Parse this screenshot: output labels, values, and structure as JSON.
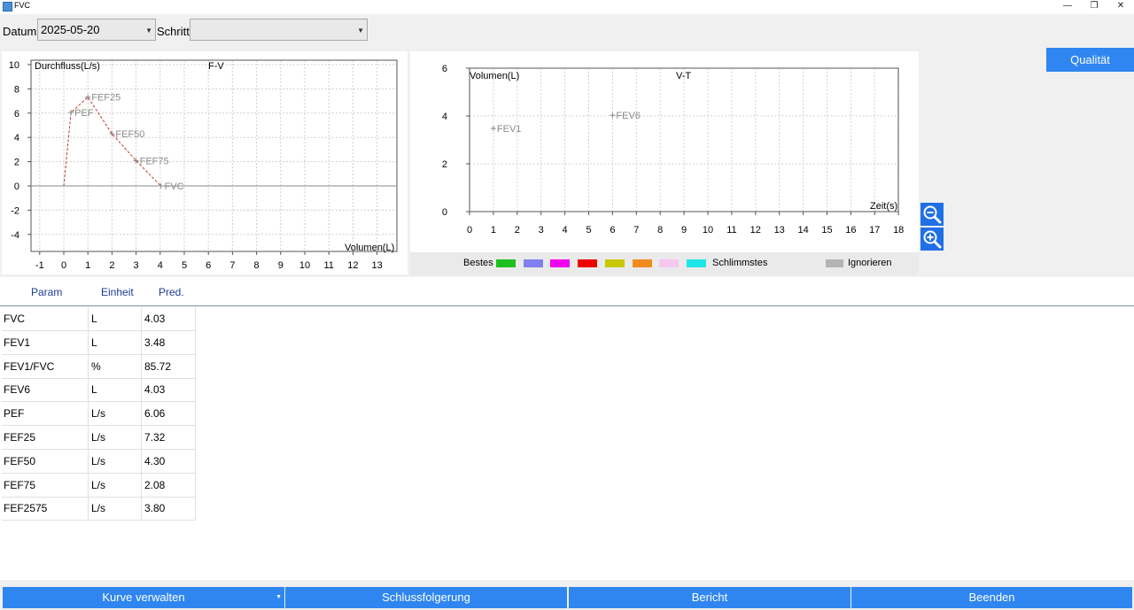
{
  "window": {
    "title": "FVC",
    "minimize": "—",
    "restore": "❐",
    "close": "✕"
  },
  "toolbar": {
    "date_label": "Datum:",
    "date_value": "2025-05-20",
    "step_label": "Schritt:",
    "step_value": ""
  },
  "fv_chart": {
    "title": "F-V",
    "ylabel": "Durchfluss(L/s)",
    "xlabel": "Volumen(L)",
    "x_ticks": [
      "-1",
      "0",
      "1",
      "2",
      "3",
      "4",
      "5",
      "6",
      "7",
      "8",
      "9",
      "10",
      "11",
      "12",
      "13"
    ],
    "y_ticks": [
      "10",
      "8",
      "6",
      "4",
      "2",
      "0",
      "-2",
      "-4"
    ],
    "points": [
      {
        "label": "",
        "x": 0,
        "y": 0
      },
      {
        "label": "PEF",
        "x": 0.3,
        "y": 6.06
      },
      {
        "label": "FEF25",
        "x": 1.0,
        "y": 7.32
      },
      {
        "label": "FEF50",
        "x": 2.0,
        "y": 4.3
      },
      {
        "label": "FEF75",
        "x": 3.0,
        "y": 2.08
      },
      {
        "label": "FVC",
        "x": 4.03,
        "y": 0
      }
    ],
    "line_color": "#c0392b"
  },
  "vt_chart": {
    "title": "V-T",
    "ylabel": "Volumen(L)",
    "xlabel": "Zeit(s)",
    "x_ticks": [
      "0",
      "1",
      "2",
      "3",
      "4",
      "5",
      "6",
      "7",
      "8",
      "9",
      "10",
      "11",
      "12",
      "13",
      "14",
      "15",
      "16",
      "17",
      "18"
    ],
    "y_ticks": [
      "6",
      "4",
      "2",
      "0"
    ],
    "points": [
      {
        "label": "FEV1",
        "x": 1,
        "y": 3.48
      },
      {
        "label": "FEV6",
        "x": 6,
        "y": 4.03
      }
    ]
  },
  "buttons": {
    "quality": "Qualität"
  },
  "zoom": {
    "out_icon": "zoom-out-icon",
    "in_icon": "zoom-in-icon"
  },
  "legend": {
    "best": "Bestes",
    "worst": "Schlimmstes",
    "ignore": "Ignorieren",
    "colors": [
      "#1fbf1f",
      "#8080f0",
      "#f000f0",
      "#f00000",
      "#c8c800",
      "#f08c1e",
      "#f5c8f0",
      "#1ee6e6"
    ],
    "ignore_color": "#b4b4b4"
  },
  "table": {
    "headers": [
      "Param",
      "Einheit",
      "Pred."
    ],
    "rows": [
      [
        "FVC",
        "L",
        "4.03"
      ],
      [
        "FEV1",
        "L",
        "3.48"
      ],
      [
        "FEV1/FVC",
        "%",
        "85.72"
      ],
      [
        "FEV6",
        "L",
        "4.03"
      ],
      [
        "PEF",
        "L/s",
        "6.06"
      ],
      [
        "FEF25",
        "L/s",
        "7.32"
      ],
      [
        "FEF50",
        "L/s",
        "4.30"
      ],
      [
        "FEF75",
        "L/s",
        "2.08"
      ],
      [
        "FEF2575",
        "L/s",
        "3.80"
      ]
    ]
  },
  "bottom": {
    "manage": "Kurve verwalten",
    "conclusion": "Schlussfolgerung",
    "report": "Bericht",
    "exit": "Beenden"
  },
  "chart_data": [
    {
      "type": "line",
      "title": "F-V",
      "xlabel": "Volumen(L)",
      "ylabel": "Durchfluss(L/s)",
      "xlim": [
        -1,
        13
      ],
      "ylim": [
        -4,
        10
      ],
      "series": [
        {
          "x": [
            0,
            0.3,
            1.0,
            2.0,
            3.0,
            4.03
          ],
          "y": [
            0,
            6.06,
            7.32,
            4.3,
            2.08,
            0
          ]
        }
      ],
      "annotations": [
        "PEF",
        "FEF25",
        "FEF50",
        "FEF75",
        "FVC"
      ],
      "grid": true
    },
    {
      "type": "scatter",
      "title": "V-T",
      "xlabel": "Zeit(s)",
      "ylabel": "Volumen(L)",
      "xlim": [
        0,
        18
      ],
      "ylim": [
        0,
        6
      ],
      "series": [
        {
          "x": [
            1,
            6
          ],
          "y": [
            3.48,
            4.03
          ]
        }
      ],
      "annotations": [
        "FEV1",
        "FEV6"
      ],
      "grid": true
    }
  ]
}
